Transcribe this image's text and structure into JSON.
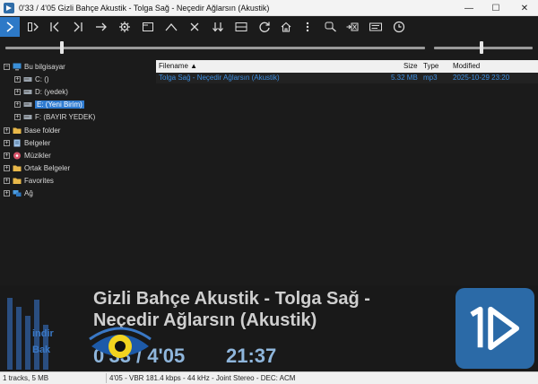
{
  "window": {
    "title": "0'33 / 4'05 Gizli Bahçe Akustik - Tolga Sağ - Neçedir Ağlarsın (Akustik)",
    "minimize": "—",
    "maximize": "☐",
    "close": "✕"
  },
  "toolbar": {
    "buttons": [
      "play-icon",
      "play-pause-icon",
      "prev-icon",
      "next-icon",
      "open-arrow-icon",
      "settings-icon",
      "window-icon",
      "up-icon",
      "x-icon",
      "sort-down-icon",
      "panel-icon",
      "refresh-icon",
      "home-icon",
      "more-icon",
      "search-icon",
      "delete-icon",
      "keyboard-icon",
      "clock-icon"
    ]
  },
  "sliders": {
    "seek_fraction": 0.135,
    "volume_fraction": 0.48
  },
  "tree": {
    "root": "Bu bilgisayar",
    "drives": [
      "C: ()",
      "D: (yedek)",
      "E: (Yeni Birim)",
      "F: (BAYIR YEDEK)"
    ],
    "selected": "E: (Yeni Birim)",
    "folders": [
      "Base folder",
      "Belgeler",
      "Müzikler",
      "Ortak Belgeler",
      "Favorites",
      "Ağ"
    ]
  },
  "list": {
    "headers": {
      "filename": "Filename",
      "size": "Size",
      "type": "Type",
      "modified": "Modified"
    },
    "sort_indicator": "▲",
    "rows": [
      {
        "filename": "Tolga Sağ - Neçedir Ağlarsın (Akustik)",
        "size": "5.32 MB",
        "type": "mp3",
        "modified": "2025-10-29 23:20"
      }
    ]
  },
  "now_playing": {
    "title": "Gizli Bahçe Akustik - Tolga Sağ - Neçedir Ağlarsın (Akustik)",
    "position": "0'33",
    "duration": "4'05",
    "clock": "21:37",
    "watermark_line1": "indir",
    "watermark_line2": "Bak"
  },
  "status": {
    "tracks": "1 tracks, 5 MB",
    "info": "4'05 - VBR 181.4 kbps - 44 kHz - Joint Stereo - DEC: ACM"
  },
  "colors": {
    "accent": "#2d79c7",
    "selection": "#2f7bd0",
    "list_text": "#3d8ee0",
    "time_text": "#8fb6dc",
    "logo_bg": "#2b6aa7"
  }
}
